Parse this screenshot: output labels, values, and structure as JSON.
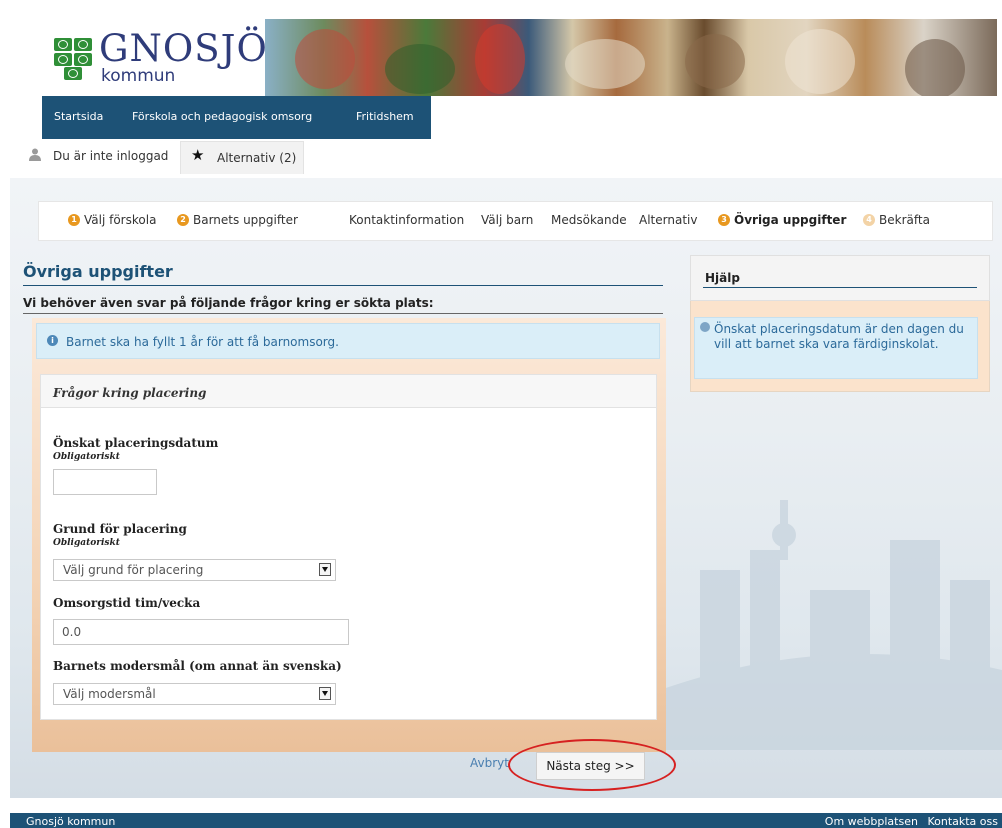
{
  "header": {
    "logo_word": "GNOSJÖ",
    "logo_sub": "kommun"
  },
  "nav": {
    "items": [
      "Startsida",
      "Förskola och pedagogisk omsorg",
      "Fritidshem"
    ]
  },
  "userbar": {
    "status": "Du är inte inloggad",
    "alternatives_tab": "Alternativ (2)"
  },
  "steps": {
    "items": [
      {
        "num": "1",
        "label": "Välj förskola"
      },
      {
        "num": "2",
        "label": "Barnets uppgifter"
      },
      {
        "num": "",
        "label": "Kontaktinformation"
      },
      {
        "num": "",
        "label": "Välj barn"
      },
      {
        "num": "",
        "label": "Medsökande"
      },
      {
        "num": "",
        "label": "Alternativ"
      },
      {
        "num": "3",
        "label": "Övriga uppgifter"
      },
      {
        "num": "4",
        "label": "Bekräfta"
      }
    ]
  },
  "main": {
    "title": "Övriga uppgifter",
    "intro": "Vi behöver även svar på följande frågor kring er sökta plats:",
    "info": "Barnet ska ha fyllt 1 år för att få barnomsorg.",
    "section_title": "Frågor kring placering",
    "fields": {
      "date_label": "Önskat placeringsdatum",
      "date_required": "Obligatoriskt",
      "date_value": "",
      "reason_label": "Grund för placering",
      "reason_required": "Obligatoriskt",
      "reason_selected": "Välj grund för placering",
      "hours_label": "Omsorgstid tim/vecka",
      "hours_value": "0.0",
      "language_label": "Barnets modersmål (om annat än svenska)",
      "language_selected": "Välj modersmål"
    },
    "cancel_label": "Avbryt",
    "next_label": "Nästa steg >>"
  },
  "help": {
    "title": "Hjälp",
    "text": "Önskat placeringsdatum är den dagen du vill att barnet ska vara färdiginskolat."
  },
  "footer": {
    "left": "Gnosjö kommun",
    "links": [
      "Om webbplatsen",
      "Kontakta oss"
    ]
  },
  "colors": {
    "brand_blue": "#1d5276",
    "step_orange": "#e8981f",
    "logo_green": "#2f8f37",
    "highlight_red": "#d62121"
  }
}
